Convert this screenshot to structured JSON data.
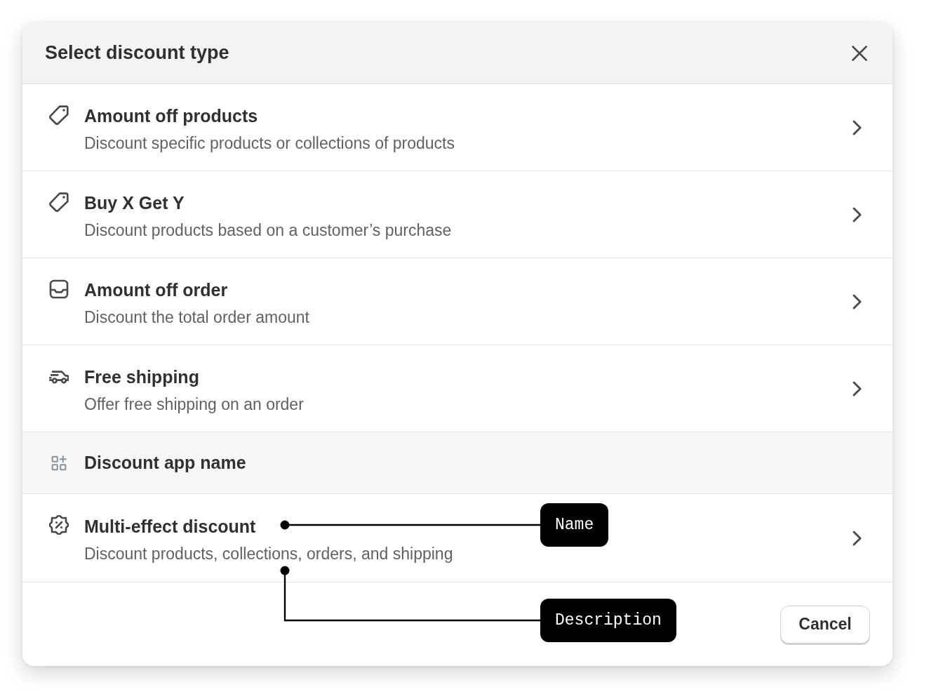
{
  "dialog": {
    "title": "Select discount type",
    "items": [
      {
        "kind": "option",
        "title": "Amount off products",
        "description": "Discount specific products or collections of products"
      },
      {
        "kind": "option",
        "title": "Buy X Get Y",
        "description": "Discount products based on a customer’s purchase"
      },
      {
        "kind": "option",
        "title": "Amount off order",
        "description": "Discount the total order amount"
      },
      {
        "kind": "option",
        "title": "Free shipping",
        "description": "Offer free shipping on an order"
      },
      {
        "kind": "section",
        "label": "Discount app name"
      },
      {
        "kind": "option",
        "title": "Multi-effect discount",
        "description": "Discount products, collections, orders, and shipping"
      }
    ],
    "footer_buttons": [
      "Cancel"
    ]
  },
  "annotations": [
    {
      "kind": "straight",
      "label": "Name"
    },
    {
      "kind": "elbow",
      "label": "Description"
    }
  ]
}
